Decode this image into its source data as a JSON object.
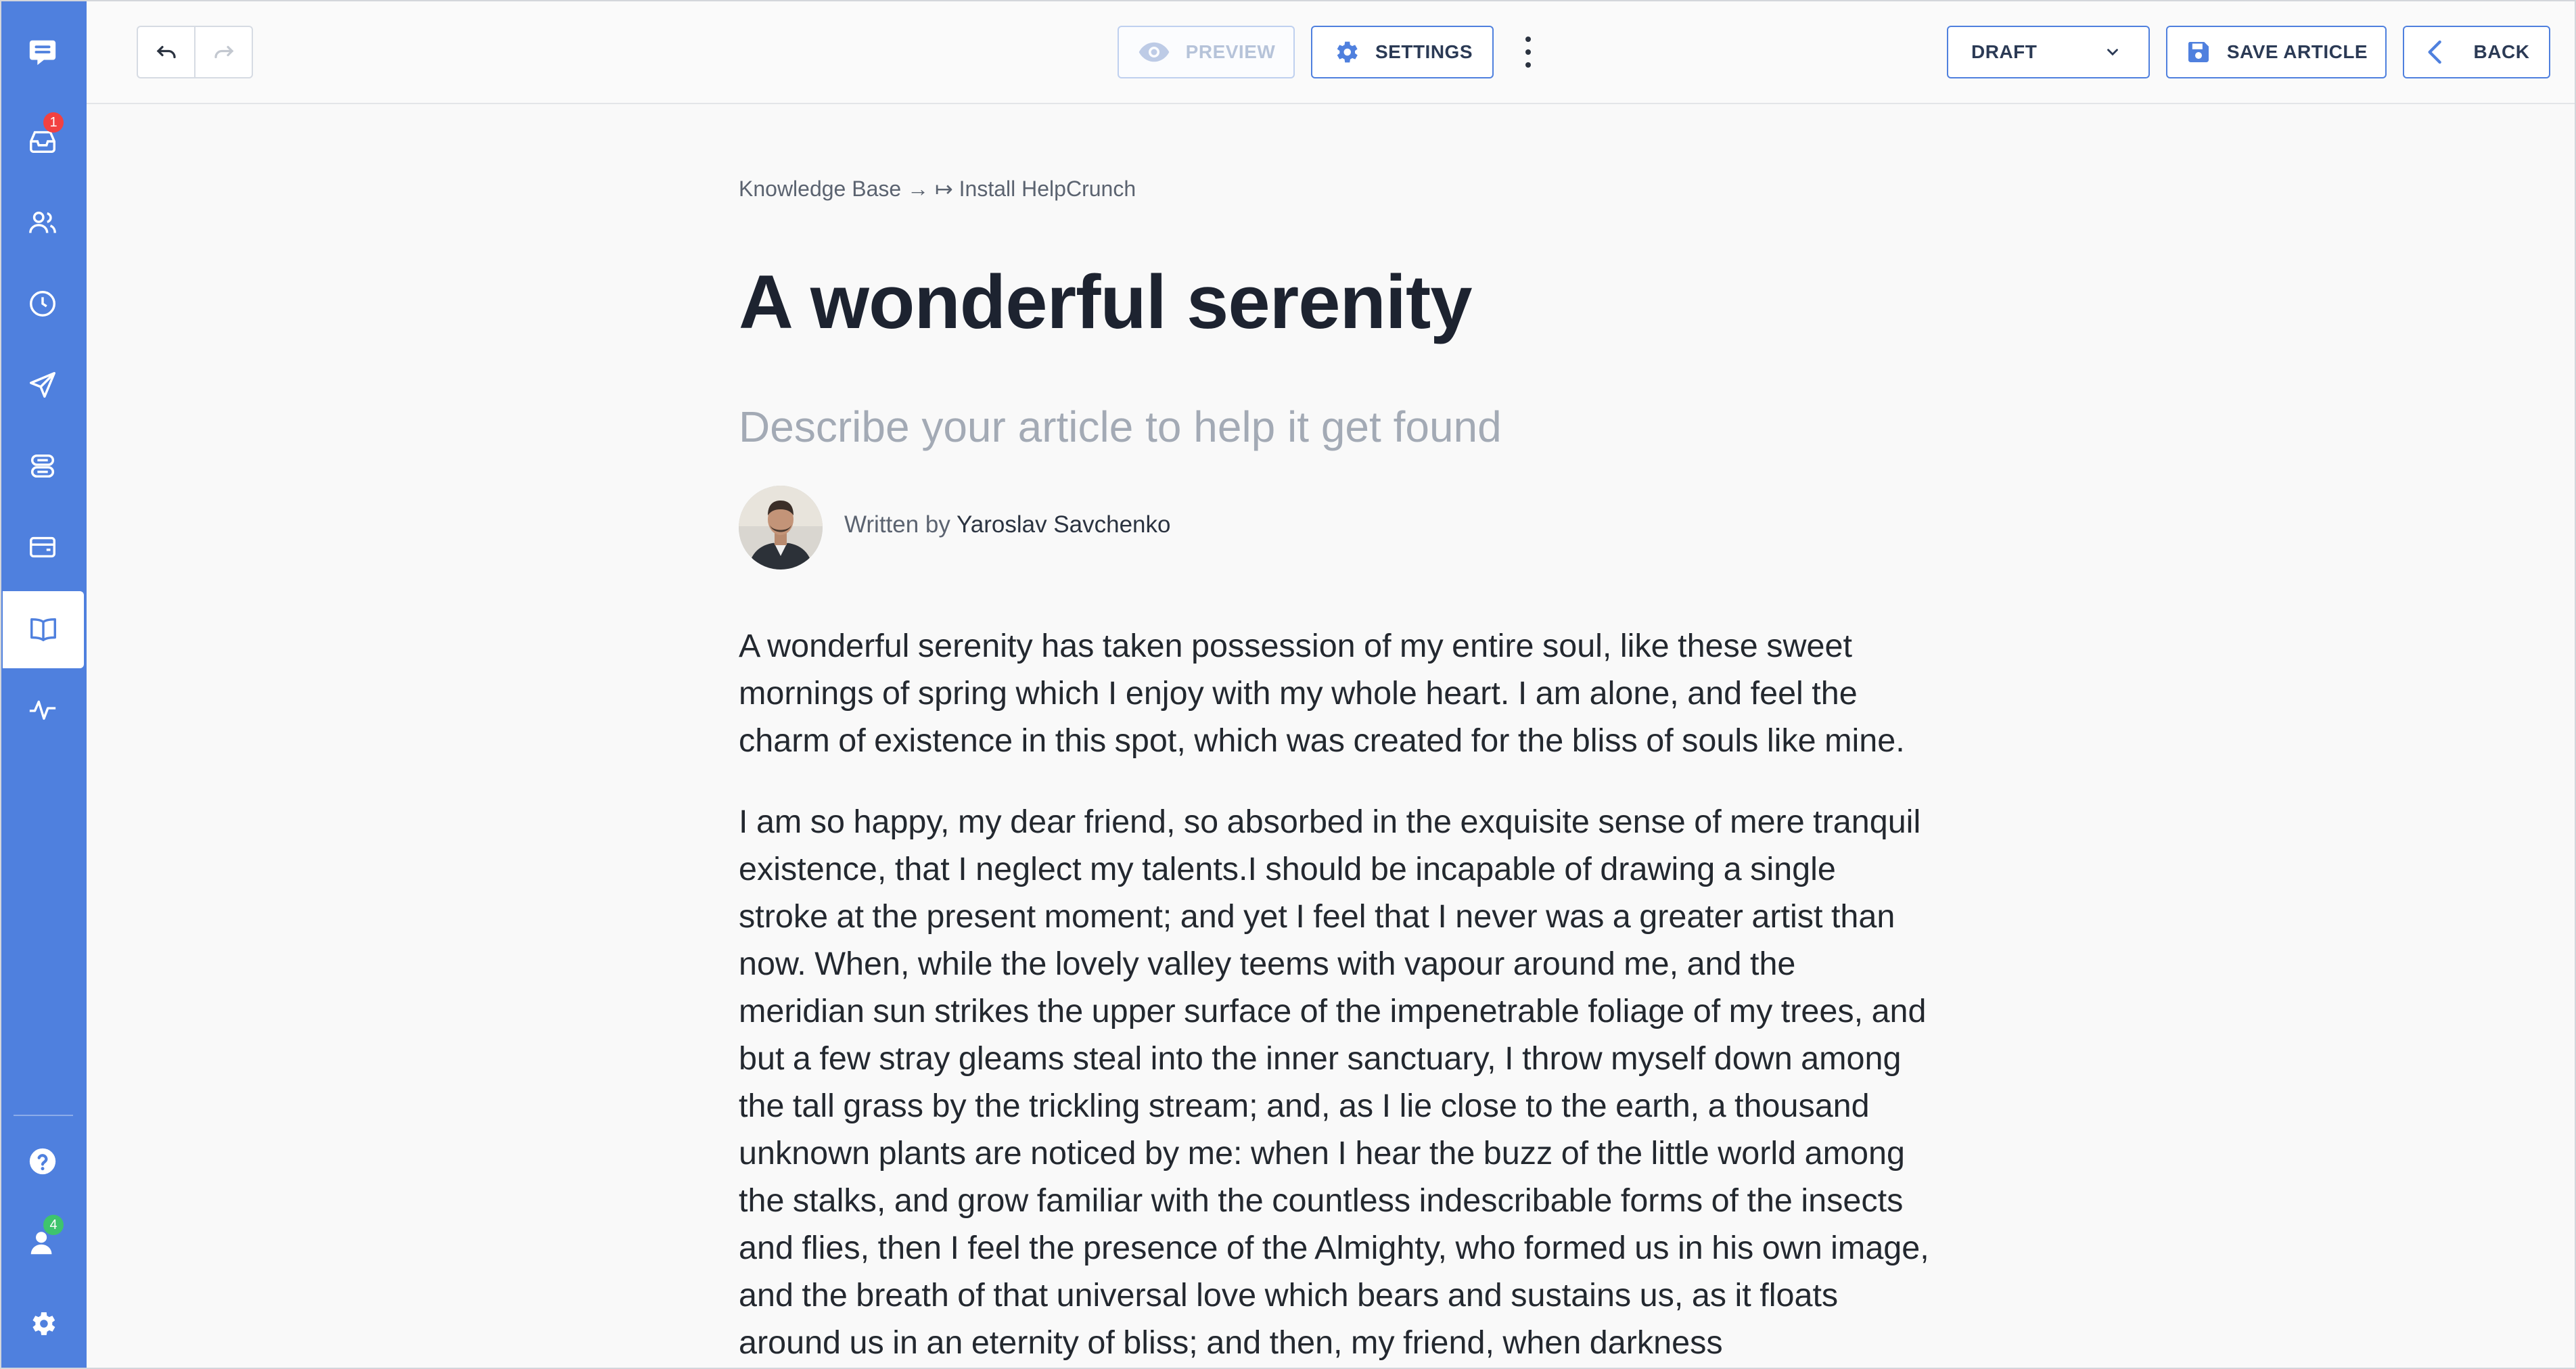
{
  "sidebar": {
    "items": [
      {
        "icon": "chat-logo-icon"
      },
      {
        "icon": "inbox-icon",
        "badge": "1",
        "badge_color": "#f24141"
      },
      {
        "icon": "contacts-icon"
      },
      {
        "icon": "clock-icon"
      },
      {
        "icon": "send-icon"
      },
      {
        "icon": "automation-icon"
      },
      {
        "icon": "widget-icon"
      },
      {
        "icon": "knowledge-base-icon",
        "active": true
      },
      {
        "icon": "statistics-icon"
      }
    ],
    "bottom": [
      {
        "icon": "help-icon"
      },
      {
        "icon": "team-icon",
        "badge": "4",
        "badge_color": "#3ec46d"
      },
      {
        "icon": "gear-icon"
      }
    ]
  },
  "toolbar": {
    "preview_label": "PREVIEW",
    "settings_label": "SETTINGS",
    "status_value": "DRAFT",
    "save_label": "SAVE ARTICLE",
    "back_label": "BACK"
  },
  "article": {
    "breadcrumb": "Knowledge Base → ↦ Install HelpCrunch",
    "title": "A wonderful serenity",
    "description_placeholder": "Describe your article to help it get found",
    "written_by": "Written by",
    "author": "Yaroslav Savchenko",
    "paragraphs": [
      "A wonderful serenity has taken possession of my entire soul, like these sweet mornings of spring which I enjoy with my whole heart. I am alone, and feel the charm of existence in this spot, which was created for the bliss of souls like mine.",
      "I am so happy, my dear friend, so absorbed in the exquisite sense of mere tranquil existence, that I neglect my talents.I should be incapable of drawing a single stroke at the present moment; and yet I feel that I never was a greater artist than now. When, while the lovely valley teems with vapour around me, and the meridian sun strikes the upper surface of the impenetrable foliage of my trees, and but a few stray gleams steal into the inner sanctuary, I throw myself down among the tall grass by the trickling stream; and, as I lie close to the earth, a thousand unknown plants are noticed by me: when I hear the buzz of the little world among the stalks, and grow familiar with the countless indescribable forms of the insects and flies, then I feel the presence of the Almighty, who formed us in his own image, and the breath of that universal love which bears and sustains us, as it floats around us in an eternity of bliss; and then, my friend, when darkness"
    ]
  },
  "colors": {
    "accent": "#4f80de",
    "sidebar": "#4f80de"
  }
}
